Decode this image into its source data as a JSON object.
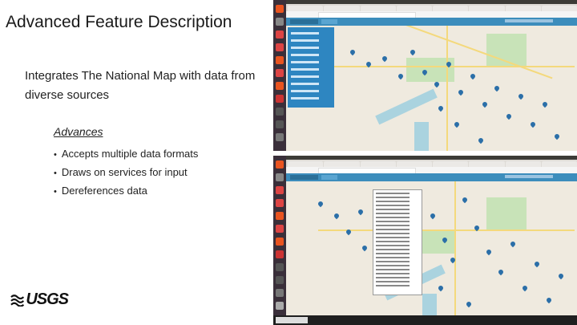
{
  "slide": {
    "title": "Advanced Feature Description",
    "body": "Integrates The National Map with data from diverse sources",
    "sub_heading": "Advances",
    "bullets": [
      "Accepts multiple data formats",
      "Draws on services for input",
      "Dereferences data"
    ],
    "logo_text": "USGS"
  },
  "colors": {
    "app_header": "#3c8dbc",
    "panel": "#2e86c1",
    "pin": "#2b6fa8",
    "launcher": "#3a2f3a"
  },
  "icons": [
    "usgs-logo-icon",
    "map-pin-icon"
  ]
}
